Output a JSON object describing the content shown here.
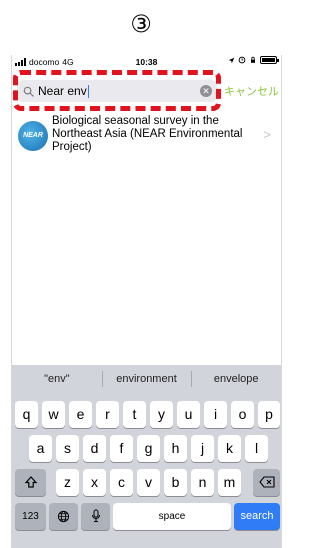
{
  "step_marker": "③",
  "status_bar": {
    "carrier": "docomo",
    "network": "4G",
    "time": "10:38",
    "icons": [
      "location-arrow",
      "alarm",
      "lock-rotation",
      "battery"
    ]
  },
  "search": {
    "value": "Near env",
    "clear_icon": "clear-circle-icon",
    "cancel_label": "キャンセル",
    "highlight_color": "#e0141e"
  },
  "results": [
    {
      "title": "Biological seasonal survey in the Northeast Asia (NEAR Environmental Project)",
      "logo_text": "NEAR"
    }
  ],
  "keyboard": {
    "predictions": [
      "\"env\"",
      "environment",
      "envelope"
    ],
    "row1": [
      "q",
      "w",
      "e",
      "r",
      "t",
      "y",
      "u",
      "i",
      "o",
      "p"
    ],
    "row2": [
      "a",
      "s",
      "d",
      "f",
      "g",
      "h",
      "j",
      "k",
      "l"
    ],
    "row3": [
      "z",
      "x",
      "c",
      "v",
      "b",
      "n",
      "m"
    ],
    "shift_icon": "shift-icon",
    "backspace_icon": "backspace-icon",
    "numbers_label": "123",
    "globe_icon": "globe-icon",
    "mic_icon": "microphone-icon",
    "space_label": "space",
    "search_label": "search"
  },
  "colors": {
    "accent_cancel": "#8cc63f",
    "search_key": "#2f7cf6"
  }
}
